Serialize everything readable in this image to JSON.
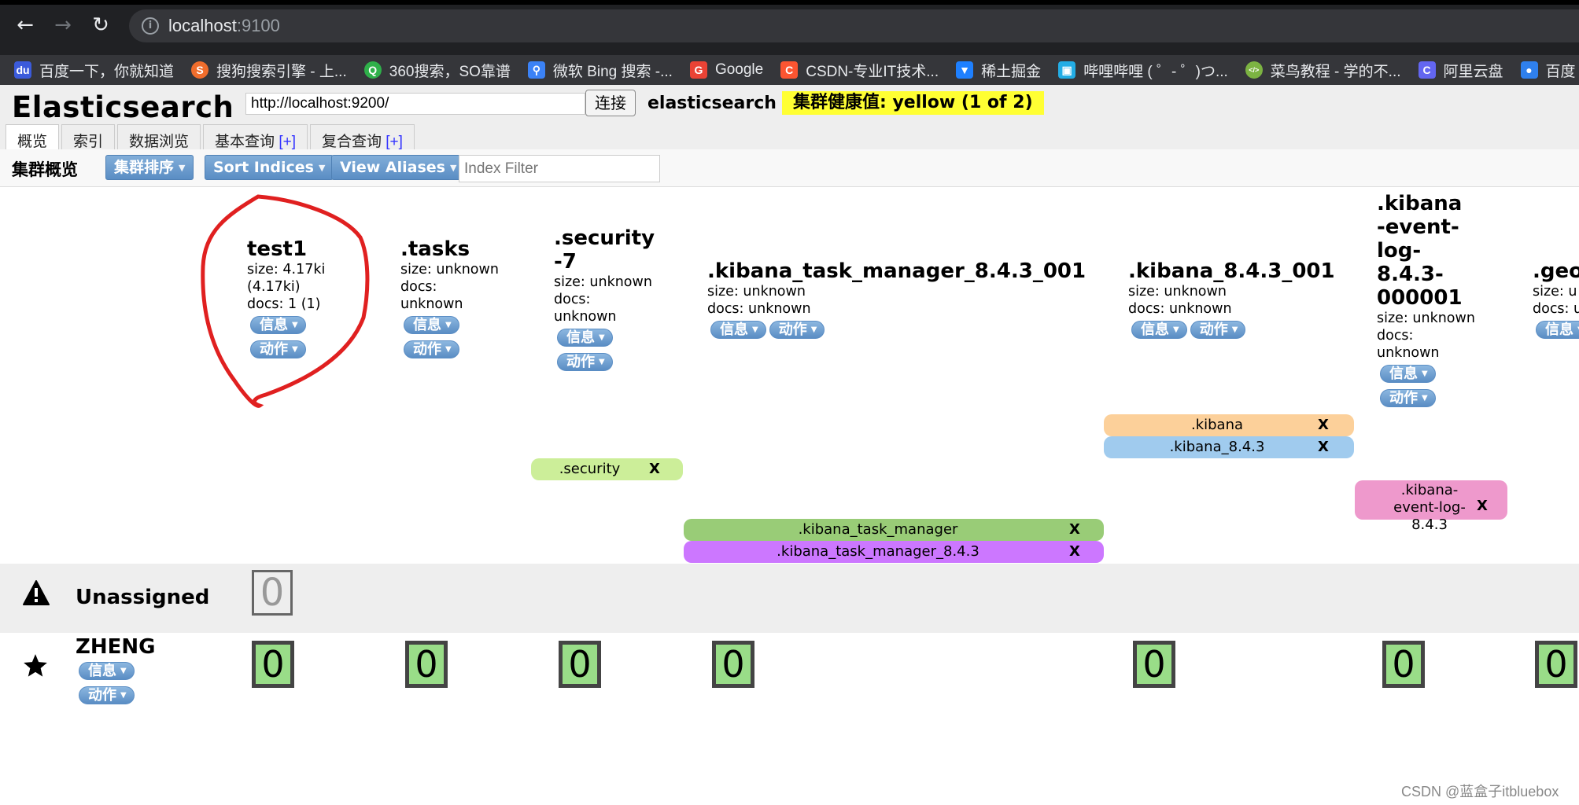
{
  "browser": {
    "url_host": "localhost",
    "url_port": ":9100",
    "bookmarks": [
      {
        "label": "百度一下，你就知道",
        "icon": "baidu-icon",
        "color": "#3b5bdb"
      },
      {
        "label": "搜狗搜索引擎 - 上...",
        "icon": "sogou-icon",
        "color": "#f06d2c"
      },
      {
        "label": "360搜索，SO靠谱",
        "icon": "so360-icon",
        "color": "#2fb04a"
      },
      {
        "label": "微软 Bing 搜索 -...",
        "icon": "search-icon",
        "color": "#3b82f6"
      },
      {
        "label": "Google",
        "icon": "google-icon",
        "color": "#ea4335"
      },
      {
        "label": "CSDN-专业IT技术...",
        "icon": "csdn-icon",
        "color": "#fc5531"
      },
      {
        "label": "稀土掘金",
        "icon": "juejin-icon",
        "color": "#1e80ff"
      },
      {
        "label": "哔哩哔哩 ( ゜- ゜)つ...",
        "icon": "bilibili-icon",
        "color": "#23ade5"
      },
      {
        "label": "菜鸟教程 - 学的不...",
        "icon": "runoob-icon",
        "color": "#7cb342"
      },
      {
        "label": "阿里云盘",
        "icon": "aliyundrive-icon",
        "color": "#6366f1"
      },
      {
        "label": "百度",
        "icon": "baidupan-icon",
        "color": "#2f80ed"
      }
    ]
  },
  "app": {
    "title": "Elasticsearch",
    "url_value": "http://localhost:9200/",
    "connect_label": "连接",
    "cluster_name": "elasticsearch",
    "health_label": "集群健康值: yellow (1 of 2)",
    "health_color": "#ffff33",
    "tabs": [
      {
        "label": "概览",
        "plus": "",
        "active": true
      },
      {
        "label": "索引",
        "plus": ""
      },
      {
        "label": "数据浏览",
        "plus": ""
      },
      {
        "label": "基本查询 ",
        "plus": "[+]"
      },
      {
        "label": "复合查询 ",
        "plus": "[+]"
      }
    ]
  },
  "toolbar": {
    "title": "集群概览",
    "cluster_sort_label": "集群排序",
    "sort_indices_label": "Sort Indices",
    "view_aliases_label": "View Aliases",
    "filter_placeholder": "Index Filter"
  },
  "buttons": {
    "info_label": "信息",
    "action_label": "动作"
  },
  "indices": [
    {
      "name": "test1",
      "size": "size: 4.17ki (4.17ki)",
      "docs": "docs: 1 (1)",
      "circled": true
    },
    {
      "name": ".tasks",
      "size": "size: unknown",
      "docs": "docs: unknown"
    },
    {
      "name": ".security-7",
      "size": "size: unknown",
      "docs": "docs: unknown"
    },
    {
      "name": ".kibana_task_manager_8.4.3_001",
      "size": "size: unknown",
      "docs": "docs: unknown"
    },
    {
      "name": ".kibana_8.4.3_001",
      "size": "size: unknown",
      "docs": "docs: unknown"
    },
    {
      "name": ".kibana-event-log-8.4.3-000001",
      "size": "size: unknown",
      "docs": "docs: unknown"
    },
    {
      "name": ".geo",
      "size": "size: u",
      "docs": "docs: u"
    }
  ],
  "aliases": [
    {
      "name": ".security",
      "remove": "X",
      "color": "#ccee99"
    },
    {
      "name": ".kibana_task_manager",
      "remove": "X",
      "color": "#99cc77"
    },
    {
      "name": ".kibana_task_manager_8.4.3",
      "remove": "X",
      "color": "#cc77ff"
    },
    {
      "name": ".kibana",
      "remove": "X",
      "color": "#fcd09a"
    },
    {
      "name": ".kibana_8.4.3",
      "remove": "X",
      "color": "#a0cbee"
    },
    {
      "name": ".kibana-event-log-8.4.3",
      "remove": "X",
      "color": "#ee99cc"
    }
  ],
  "unassigned": {
    "label": "Unassigned",
    "shards": [
      "0"
    ]
  },
  "node": {
    "name": "ZHENG",
    "shards": [
      "0",
      "0",
      "0",
      "0",
      "0",
      "0",
      "0"
    ]
  },
  "watermark": "CSDN @蓝盒子itbluebox"
}
